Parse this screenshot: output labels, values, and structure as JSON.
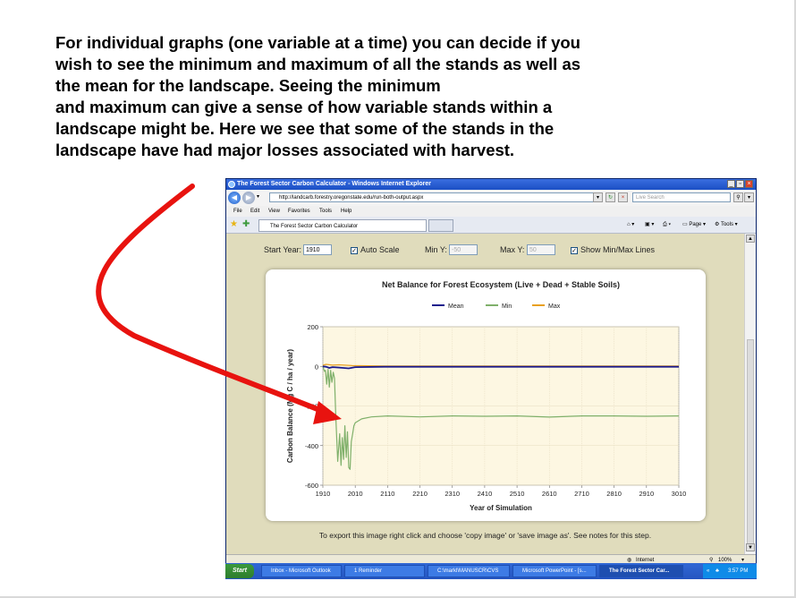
{
  "slide": {
    "lines": [
      "For individual graphs (one variable at a time) you can decide if you",
      "wish to see the minimum and maximum of all the stands as well as",
      "the mean for the landscape. Seeing the minimum",
      "and maximum can give a sense of how variable stands within a",
      "landscape might be. Here we see that some of the stands in the",
      "landscape have had major losses associated with harvest."
    ],
    "arrow_color": "#e8130f"
  },
  "browser": {
    "title": "The Forest Sector Carbon Calculator - Windows Internet Explorer",
    "url": "http://landcarb.forestry.oregonstate.edu/run-both-output.aspx",
    "search_placeholder": "Live Search",
    "menu": [
      "File",
      "Edit",
      "View",
      "Favorites",
      "Tools",
      "Help"
    ],
    "tab_label": "The Forest Sector Carbon Calculator",
    "commands": {
      "page": "Page",
      "tools": "Tools"
    },
    "status_zone": "Internet",
    "zoom": "100%"
  },
  "controls": {
    "start_year_label": "Start Year:",
    "start_year_value": "1910",
    "auto_scale_label": "Auto Scale",
    "auto_scale_checked": true,
    "min_y_label": "Min Y:",
    "min_y_value": "-50",
    "max_y_label": "Max Y:",
    "max_y_value": "50",
    "show_minmax_label": "Show Min/Max Lines",
    "show_minmax_checked": true
  },
  "export_note": "To export this image right click and choose 'copy image' or 'save image as'. See notes for this step.",
  "chart_data": {
    "type": "line",
    "title": "Net Balance for Forest Ecosystem (Live + Dead + Stable Soils)",
    "xlabel": "Year of Simulation",
    "ylabel": "Carbon Balance (Mg C / ha / year)",
    "xlim": [
      1910,
      3010
    ],
    "ylim": [
      -600,
      200
    ],
    "x_ticks": [
      1910,
      2010,
      2110,
      2210,
      2310,
      2410,
      2510,
      2610,
      2710,
      2810,
      2910,
      3010
    ],
    "y_ticks": [
      200,
      0,
      -200,
      -400,
      -600
    ],
    "legend_position": "top-center",
    "series": [
      {
        "name": "Mean",
        "color": "#1a1a8c",
        "x": [
          1910,
          1920,
          1930,
          1940,
          1960,
          1990,
          2010,
          2100,
          2500,
          3010
        ],
        "y": [
          0,
          -2,
          -8,
          -4,
          -6,
          -10,
          -4,
          -2,
          -2,
          -2
        ]
      },
      {
        "name": "Min",
        "color": "#7fb06a",
        "x": [
          1910,
          1915,
          1918,
          1922,
          1926,
          1930,
          1934,
          1938,
          1942,
          1946,
          1950,
          1956,
          1962,
          1966,
          1970,
          1974,
          1978,
          1982,
          1986,
          1990,
          1994,
          1998,
          2002,
          2006,
          2010,
          2030,
          2060,
          2110,
          2210,
          2310,
          2410,
          2510,
          2610,
          2710,
          2810,
          2910,
          3010
        ],
        "y": [
          0,
          -25,
          -20,
          -90,
          -15,
          -105,
          -20,
          -80,
          -30,
          -60,
          -260,
          -480,
          -340,
          -500,
          -360,
          -470,
          -300,
          -460,
          -330,
          -510,
          -520,
          -380,
          -340,
          -300,
          -285,
          -265,
          -255,
          -250,
          -255,
          -250,
          -252,
          -250,
          -256,
          -250,
          -250,
          -252,
          -250
        ]
      },
      {
        "name": "Max",
        "color": "#e8a020",
        "x": [
          1910,
          1920,
          1940,
          1960,
          2000,
          2100,
          2500,
          3010
        ],
        "y": [
          6,
          10,
          6,
          8,
          4,
          2,
          2,
          2
        ]
      }
    ]
  },
  "taskbar": {
    "start": "Start",
    "items": [
      "Inbox - Microsoft Outlook",
      "1 Reminder",
      "C:\\markl\\MANUSCR\\CVS",
      "Microsoft PowerPoint - [s...",
      "The Forest Sector Car..."
    ],
    "clock": "3:57 PM"
  }
}
